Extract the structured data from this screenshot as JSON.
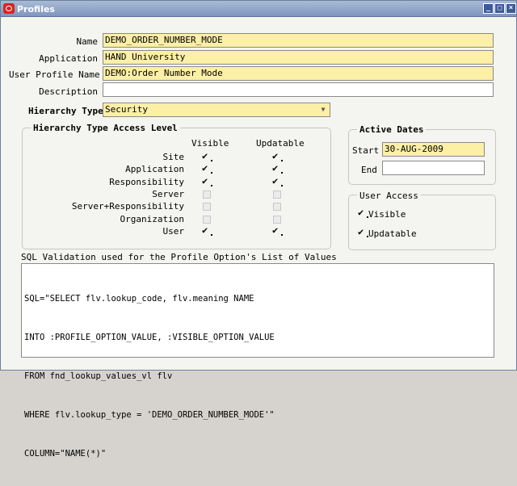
{
  "window": {
    "title": "Profiles",
    "buttons": {
      "minimize": "_",
      "maximize": "□",
      "close": "×"
    }
  },
  "form": {
    "name_label": "Name",
    "name_value": "DEMO_ORDER_NUMBER_MODE",
    "application_label": "Application",
    "application_value": "HAND University",
    "user_profile_name_label": "User Profile Name",
    "user_profile_name_value": "DEMO:Order Number Mode",
    "description_label": "Description",
    "description_value": "",
    "hierarchy_type_label": "Hierarchy Type",
    "hierarchy_type_value": "Security"
  },
  "access_level": {
    "title": "Hierarchy Type Access Level",
    "visible_header": "Visible",
    "updatable_header": "Updatable",
    "rows": [
      {
        "label": "Site",
        "visible": true,
        "updatable": true
      },
      {
        "label": "Application",
        "visible": true,
        "updatable": true
      },
      {
        "label": "Responsibility",
        "visible": true,
        "updatable": true
      },
      {
        "label": "Server",
        "visible": false,
        "updatable": false
      },
      {
        "label": "Server+Responsibility",
        "visible": false,
        "updatable": false
      },
      {
        "label": "Organization",
        "visible": false,
        "updatable": false
      },
      {
        "label": "User",
        "visible": true,
        "updatable": true
      }
    ]
  },
  "active_dates": {
    "title": "Active Dates",
    "start_label": "Start",
    "start_value": "30-AUG-2009",
    "end_label": "End",
    "end_value": ""
  },
  "user_access": {
    "title": "User Access",
    "visible_label": "Visible",
    "visible_checked": true,
    "updatable_label": "Updatable",
    "updatable_checked": true
  },
  "sql": {
    "label": "SQL Validation used for the Profile Option's List of Values",
    "lines": [
      "SQL=\"SELECT flv.lookup_code, flv.meaning NAME",
      "INTO :PROFILE_OPTION_VALUE, :VISIBLE_OPTION_VALUE",
      "FROM fnd_lookup_values_vl flv",
      "WHERE flv.lookup_type = 'DEMO_ORDER_NUMBER_MODE'\"",
      "COLUMN=\"NAME(*)\""
    ]
  }
}
